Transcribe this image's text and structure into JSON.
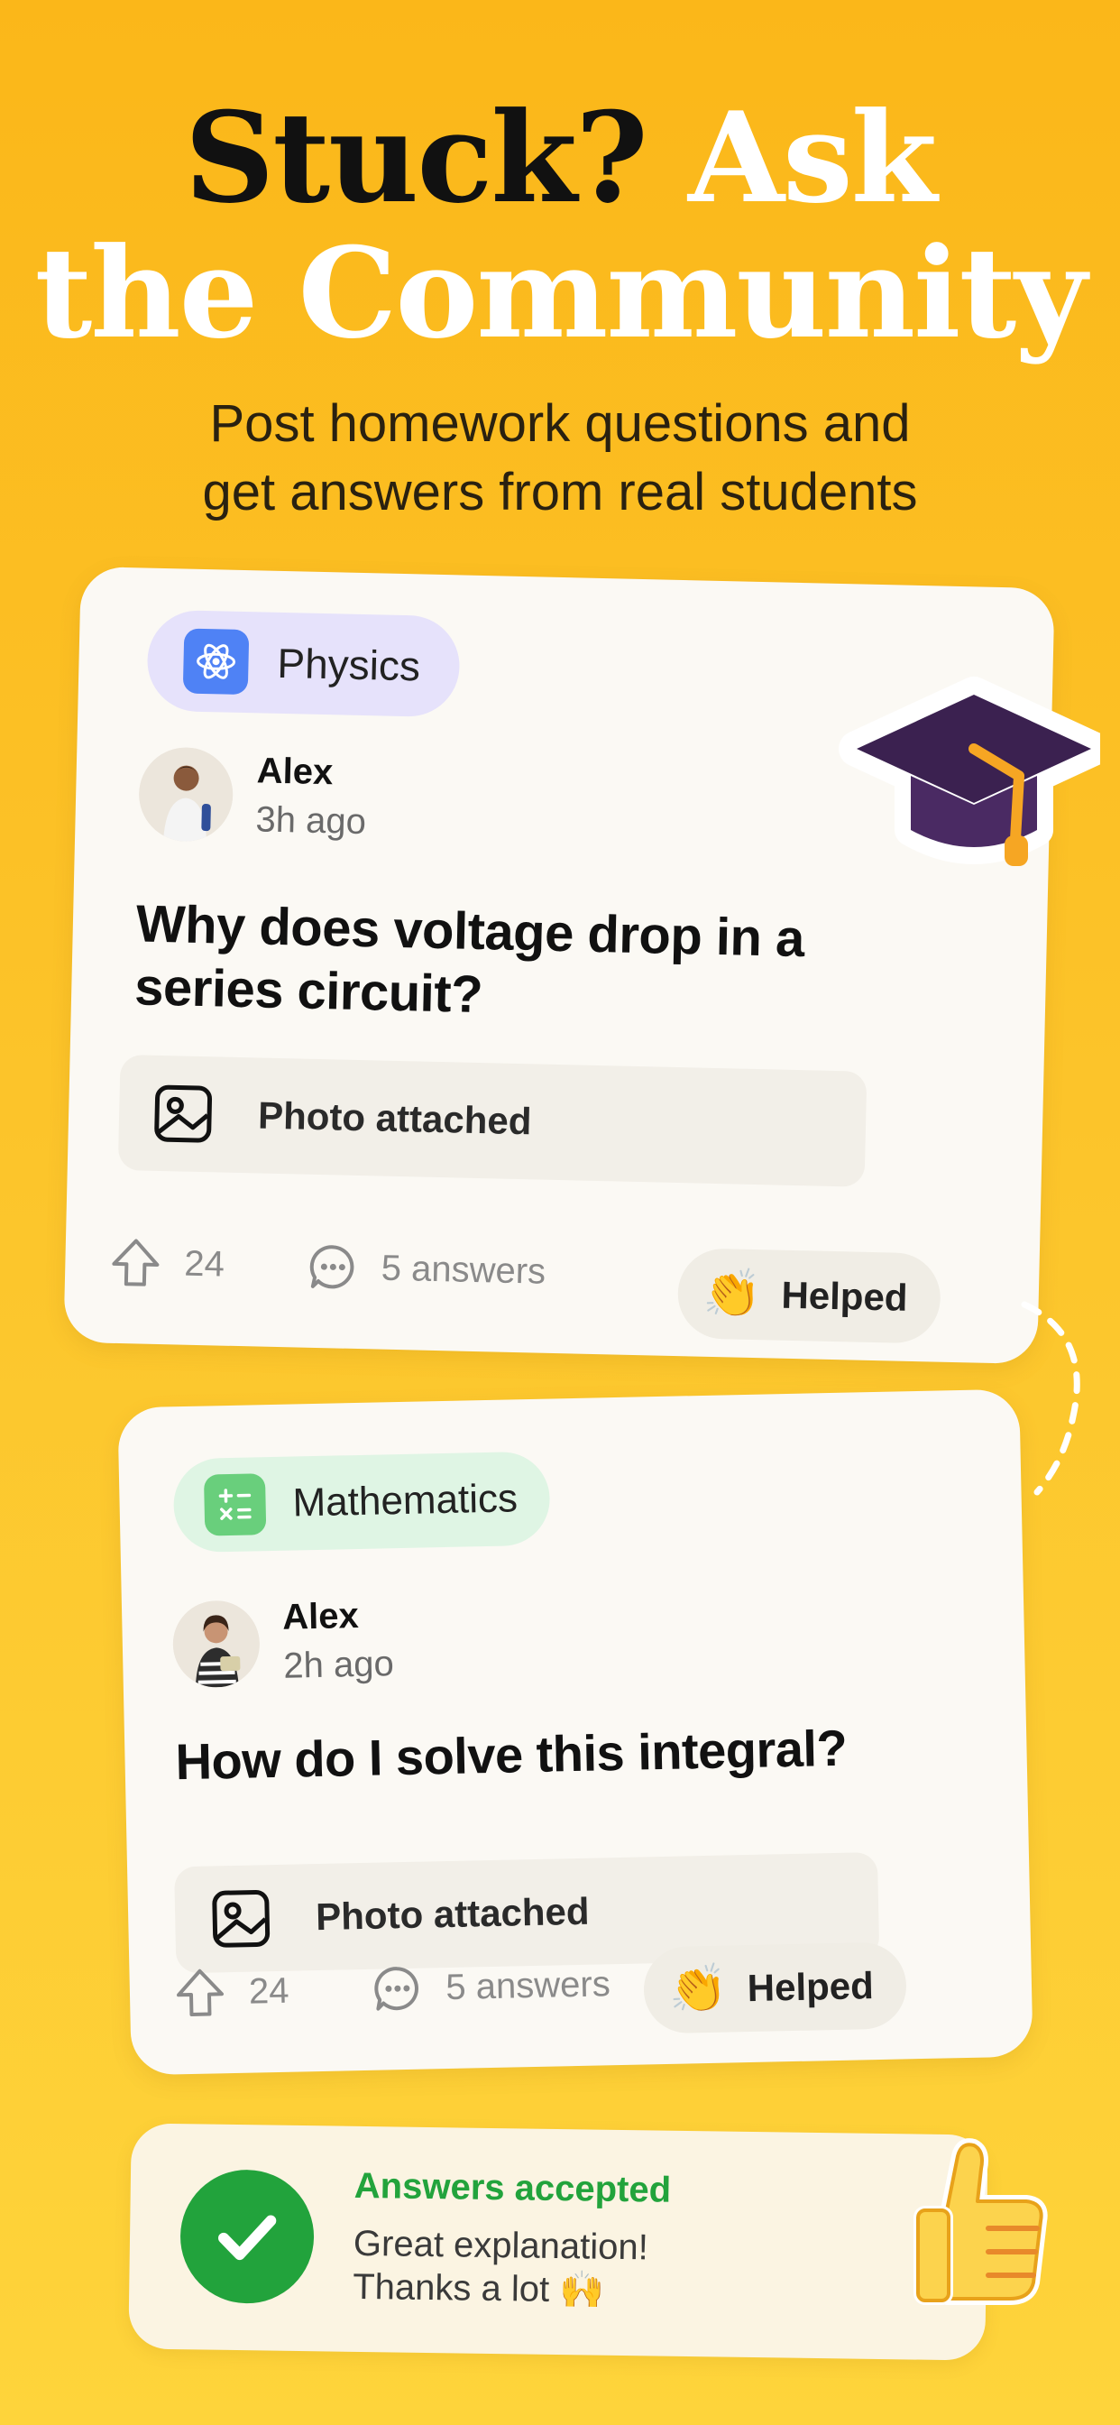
{
  "headline": {
    "part1": "Stuck?",
    "part2": "Ask",
    "part3": "the Community"
  },
  "subhead": {
    "line1": "Post homework questions and",
    "line2": "get answers from real students"
  },
  "posts": [
    {
      "subject": "Physics",
      "subject_icon": "atom-icon",
      "author": "Alex",
      "time": "3h ago",
      "question": "Why does voltage drop in a series circuit?",
      "attachment": "Photo attached",
      "votes": "24",
      "answers": "5 answers",
      "helped": "Helped",
      "helped_emoji": "👏"
    },
    {
      "subject": "Mathematics",
      "subject_icon": "calculator-icon",
      "author": "Alex",
      "time": "2h ago",
      "question": "How do I solve this integral?",
      "attachment": "Photo attached",
      "votes": "24",
      "answers": "5 answers",
      "helped": "Helped",
      "helped_emoji": "👏"
    }
  ],
  "accepted": {
    "title": "Answers accepted",
    "line1": "Great explanation!",
    "line2": "Thanks a lot 🙌"
  },
  "colors": {
    "background_top": "#fbb719",
    "background_bottom": "#fed43b",
    "physics_chip": "#e6e2fb",
    "physics_icon": "#4f82f5",
    "math_chip": "#dff5e4",
    "math_icon": "#69cf7c",
    "accepted_green": "#22a33c",
    "grad_cap": "#3b2150"
  }
}
